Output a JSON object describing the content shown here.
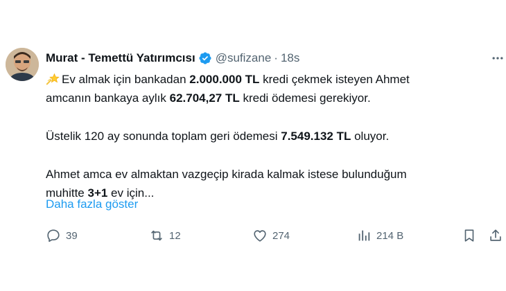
{
  "author": {
    "name": "Murat - Temettü Yatırımcısı",
    "handle": "@sufizane",
    "separator": "·",
    "time": "18s",
    "verified": true
  },
  "body": {
    "p1_l1": {
      "pre": "Ev almak için bankadan ",
      "bold": "2.000.000 TL",
      "post": " kredi çekmek isteyen Ahmet"
    },
    "p1_l2": {
      "pre": "amcanın bankaya aylık ",
      "bold": "62.704,27 TL",
      "post": " kredi ödemesi gerekiyor."
    },
    "p2": {
      "pre": "Üstelik 120 ay sonunda toplam geri ödemesi ",
      "bold": "7.549.132 TL",
      "post": " oluyor."
    },
    "p3_l1": "Ahmet amca ev almaktan vazgeçip kirada kalmak istese bulunduğum",
    "p3_l2": {
      "pre": "muhitte ",
      "bold": "3+1",
      "post": " ev için..."
    },
    "leading_emoji": "shooting-star-emoji"
  },
  "show_more": "Daha fazla göster",
  "more_icon": "more-dots-icon",
  "actions": {
    "reply": {
      "icon": "reply-icon",
      "count": "39"
    },
    "repost": {
      "icon": "repost-icon",
      "count": "12"
    },
    "like": {
      "icon": "like-icon",
      "count": "274"
    },
    "views": {
      "icon": "views-icon",
      "count": "214 B"
    },
    "bookmark": {
      "icon": "bookmark-icon"
    },
    "share": {
      "icon": "share-icon"
    }
  },
  "colors": {
    "text": "#0f1419",
    "secondary": "#536471",
    "link": "#1d9bf0",
    "verified": "#1d9bf0"
  }
}
